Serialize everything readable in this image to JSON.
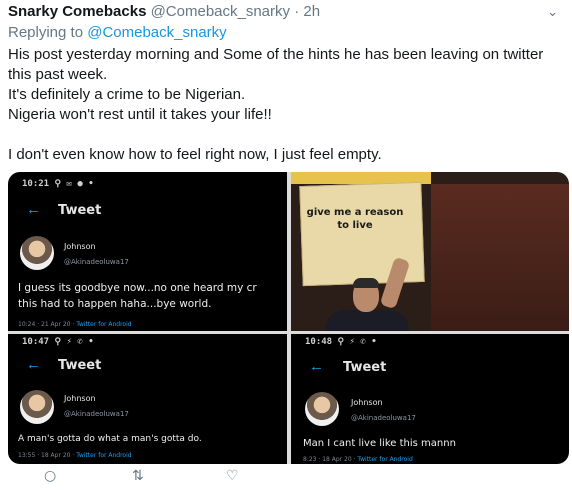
{
  "tweet": {
    "author": "Snarky Comebacks",
    "handle": "@Comeback_snarky",
    "dot": "·",
    "time": "2h",
    "caret": "⌄",
    "replying_prefix": "Replying to ",
    "replying_to": "@Comeback_snarky",
    "lines": [
      "His post yesterday morning and Some of the hints he has been leaving on twitter",
      "this past week.",
      "It's definitely a crime to be Nigerian.",
      "Nigeria won't rest until it takes your life!!",
      "I don't even know how to feel right now, I just feel empty."
    ]
  },
  "media": {
    "s1": {
      "status": "10:21 ⚲ ✉ ● •",
      "back": "←",
      "title": "Tweet",
      "name": "Johnson",
      "handle": "@Akinadeoluwa17",
      "text_line1": "I guess its goodbye now...no one heard my cr",
      "text_line2": "this had to happen haha...bye world.",
      "meta_date": "10:24 · 21 Apr 20 · ",
      "meta_src": "Twitter for Android"
    },
    "s2": {
      "sign_text": "give me a reason to live"
    },
    "s3": {
      "status": "10:47 ⚲ ⚡ ✆ •",
      "back": "←",
      "title": "Tweet",
      "name": "Johnson",
      "handle": "@Akinadeoluwa17",
      "text": "A man's gotta do what a man's gotta do.",
      "meta_date": "13:55 · 18 Apr 20 · ",
      "meta_src": "Twitter for Android",
      "reply_icon": "○",
      "retweet_icon": "⇅",
      "like_icon": "♡"
    },
    "s4": {
      "status": "10:48 ⚲ ⚡ ✆ •",
      "back": "←",
      "title": "Tweet",
      "name": "Johnson",
      "handle": "@Akinadeoluwa17",
      "text": "Man I cant live like this mannn",
      "meta_date": "8:23 · 18 Apr 20 · ",
      "meta_src": "Twitter for Android"
    }
  },
  "actions": {
    "reply_icon": "○",
    "retweet_icon": "⇅",
    "like_icon": "♡"
  }
}
